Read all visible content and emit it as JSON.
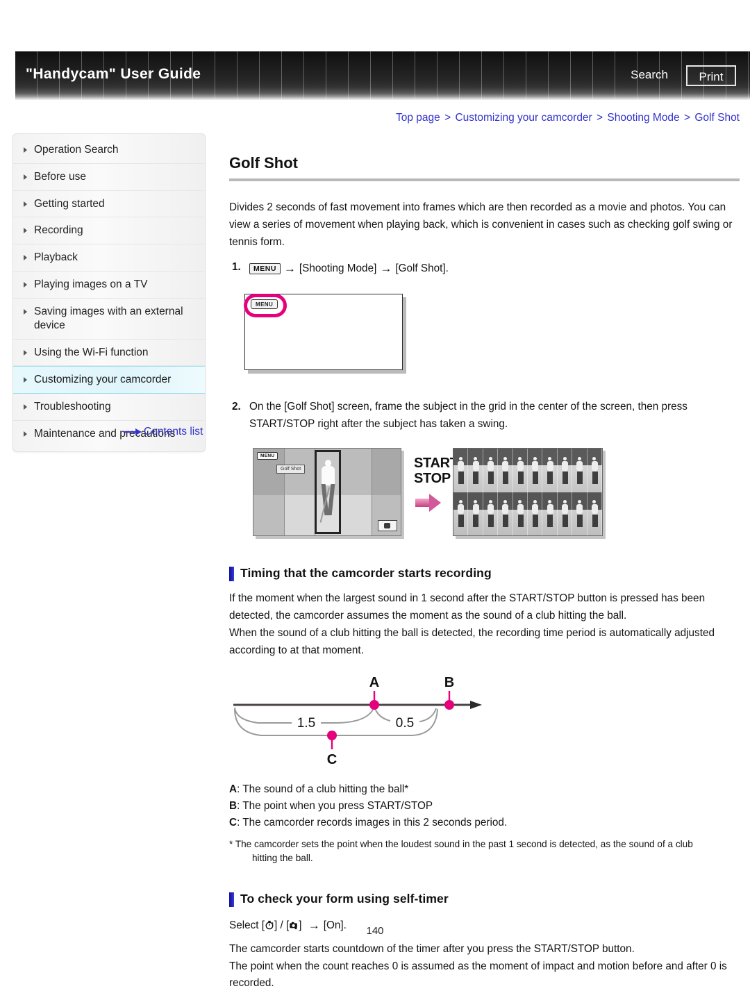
{
  "header": {
    "title": "\"Handycam\" User Guide",
    "search_label": "Search",
    "print_label": "Print"
  },
  "breadcrumb": {
    "items": [
      "Top page",
      "Customizing your camcorder",
      "Shooting Mode",
      "Golf Shot"
    ],
    "separator": ">",
    "link_color": "#3333cc"
  },
  "sidebar": {
    "items": [
      {
        "label": "Operation Search",
        "selected": false
      },
      {
        "label": "Before use",
        "selected": false
      },
      {
        "label": "Getting started",
        "selected": false
      },
      {
        "label": "Recording",
        "selected": false
      },
      {
        "label": "Playback",
        "selected": false
      },
      {
        "label": "Playing images on a TV",
        "selected": false
      },
      {
        "label": "Saving images with an external device",
        "selected": false
      },
      {
        "label": "Using the Wi-Fi function",
        "selected": false
      },
      {
        "label": "Customizing your camcorder",
        "selected": true
      },
      {
        "label": "Troubleshooting",
        "selected": false
      },
      {
        "label": "Maintenance and precautions",
        "selected": false
      }
    ],
    "contents_link": "Contents list",
    "selected_color": "#dff5fb"
  },
  "main": {
    "title": "Golf Shot",
    "intro": "Divides 2 seconds of fast movement into frames which are then recorded as a movie and photos. You can view a series of movement when playing back, which is convenient in cases such as checking golf swing or tennis form.",
    "steps": [
      {
        "num": "1.",
        "menu_chip": "MENU",
        "arrow": "→",
        "part1": "[Shooting Mode]",
        "part2": "[Golf Shot]."
      },
      {
        "num": "2.",
        "text": "On the [Golf Shot] screen, frame the subject in the grid in the center of the screen, then press START/STOP right after the subject has taken a swing."
      }
    ],
    "figure1": {
      "menu_button_label": "MENU",
      "highlight_color": "#e5007e"
    },
    "figure2": {
      "menu_button_label": "MENU",
      "mode_label": "Golf Shot",
      "start_stop_line1": "START/",
      "start_stop_line2": "STOP",
      "arrow_color": "#d2599a"
    },
    "section1": {
      "heading": "Timing that the camcorder starts recording",
      "para1": "If the moment when the largest sound in 1 second after the START/STOP button is pressed has been detected, the camcorder assumes the moment as the sound of a club hitting the ball.",
      "para2": "When the sound of a club hitting the ball is detected, the recording time period is automatically adjusted according to at that moment."
    },
    "timing_diagram": {
      "marker_a": "A",
      "marker_b": "B",
      "marker_c": "C",
      "span_left": "1.5",
      "span_right": "0.5",
      "marker_color": "#e5007e"
    },
    "legend": [
      {
        "key": "A",
        "text": ": The sound of a club hitting the ball*"
      },
      {
        "key": "B",
        "text": ": The point when you press START/STOP"
      },
      {
        "key": "C",
        "text": ": The camcorder records images in this 2 seconds period."
      }
    ],
    "footnote": {
      "line1": "* The camcorder sets the point when the loudest sound in the past 1 second is detected, as the sound of a club",
      "line2": "hitting the ball."
    },
    "section2": {
      "heading": "To check your form using self-timer",
      "select_prefix": "Select [",
      "select_mid": "] / [",
      "select_arrow": "→",
      "select_suffix": "] ",
      "select_end": "[On].",
      "para1": "The camcorder starts countdown of the timer after you press the START/STOP button.",
      "para2": "The point when the count reaches 0 is assumed as the moment of impact and motion before and after 0 is recorded."
    }
  },
  "footer": {
    "page_number": "140"
  }
}
